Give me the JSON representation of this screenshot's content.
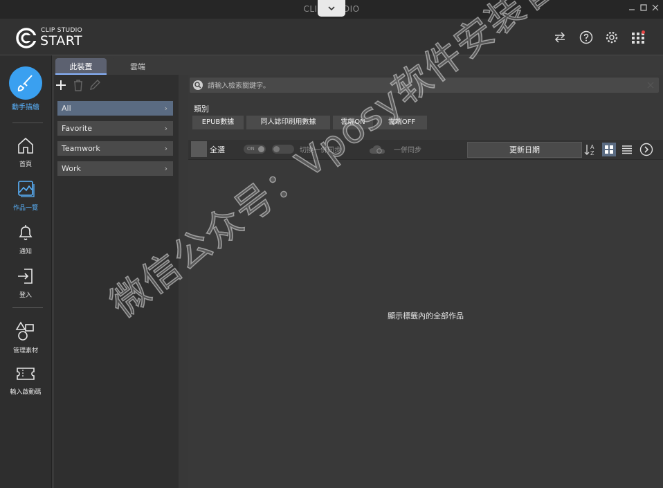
{
  "window": {
    "title": "CLIP STUDIO"
  },
  "header": {
    "brand_small": "CLIP STUDIO",
    "brand_big": "START"
  },
  "sidebar": {
    "items": [
      {
        "label": "動手描繪",
        "icon": "brush-icon"
      },
      {
        "label": "首頁",
        "icon": "home-icon"
      },
      {
        "label": "作品一覽",
        "icon": "gallery-icon"
      },
      {
        "label": "通知",
        "icon": "bell-icon"
      },
      {
        "label": "登入",
        "icon": "login-icon"
      },
      {
        "label": "管理素材",
        "icon": "shapes-icon"
      },
      {
        "label": "輸入啟動碼",
        "icon": "ticket-icon"
      }
    ]
  },
  "tabs": [
    {
      "label": "此裝置"
    },
    {
      "label": "雲端"
    }
  ],
  "tags": [
    {
      "label": "All"
    },
    {
      "label": "Favorite"
    },
    {
      "label": "Teamwork"
    },
    {
      "label": "Work"
    }
  ],
  "search": {
    "placeholder": "請輸入檢索關鍵字。"
  },
  "category": {
    "label": "類別",
    "chips": [
      "EPUB數據",
      "同人誌印刷用數據",
      "雲端ON",
      "雲端OFF"
    ]
  },
  "toolbar": {
    "select_all": "全選",
    "toggle1": "ON",
    "toggle2_text": "切換一併同步",
    "sync_text": "一併同步",
    "sort": "更新日期"
  },
  "main": {
    "empty_message": "顯示標籤內的全部作品"
  },
  "watermark": "微信公众号：Vposy软件安装管家",
  "colors": {
    "accent": "#3aa0f0",
    "selected_tag": "#5a6b82"
  }
}
